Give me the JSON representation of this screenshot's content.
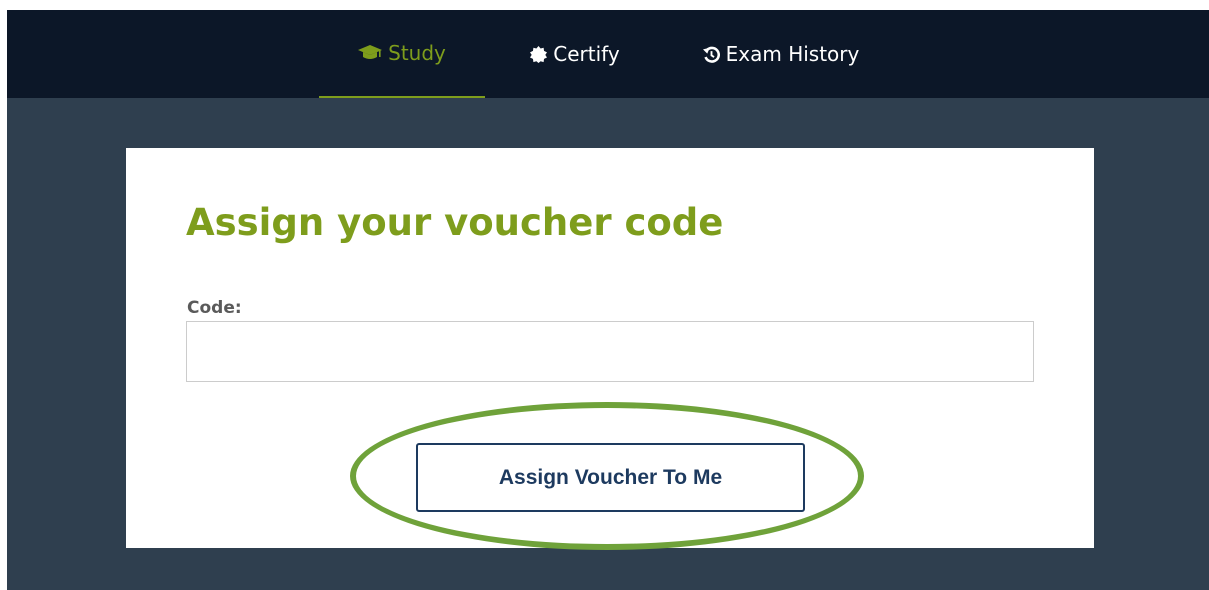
{
  "nav": {
    "items": [
      {
        "label": "Study",
        "icon": "graduation-cap-icon",
        "active": true
      },
      {
        "label": "Certify",
        "icon": "badge-icon",
        "active": false
      },
      {
        "label": "Exam History",
        "icon": "history-icon",
        "active": false
      }
    ]
  },
  "card": {
    "title": "Assign your voucher code",
    "code_label": "Code:",
    "code_value": "",
    "button_label": "Assign Voucher To Me"
  },
  "colors": {
    "nav_background": "#0c1728",
    "page_background": "#2f3f4f",
    "accent_green": "#7e9d1c",
    "button_blue": "#1d3a5f",
    "highlight_ring": "#6fa23a"
  }
}
